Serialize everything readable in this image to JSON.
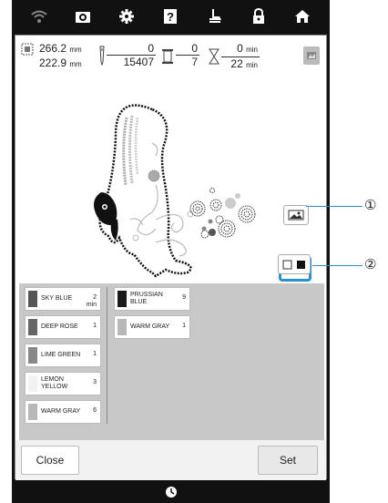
{
  "status_icons": [
    "wifi-icon",
    "camera-icon",
    "settings-gear-icon",
    "help-icon",
    "presser-foot-icon",
    "lock-icon",
    "home-icon"
  ],
  "info": {
    "width_value": "266.2",
    "width_unit": "mm",
    "height_value": "222.9",
    "height_unit": "mm",
    "stitch_current": "0",
    "stitch_total": "15407",
    "color_current": "0",
    "color_total": "7",
    "time_current": "0",
    "time_current_unit": "min",
    "time_total": "22",
    "time_total_unit": "min"
  },
  "thread_list": {
    "left_column": [
      {
        "name": "SKY BLUE",
        "count": "2",
        "unit": "min",
        "color": "#555555"
      },
      {
        "name": "DEEP ROSE",
        "count": "1",
        "color": "#666666"
      },
      {
        "name": "LIME GREEN",
        "count": "1",
        "color": "#888888"
      },
      {
        "name": "LEMON YELLOW",
        "count": "3",
        "color": "#f2f2f2"
      },
      {
        "name": "WARM GRAY",
        "count": "6",
        "color": "#b8b8b8"
      }
    ],
    "right_column": [
      {
        "name": "PRUSSIAN BLUE",
        "count": "9",
        "color": "#1a1a1a"
      },
      {
        "name": "WARM GRAY",
        "count": "1",
        "color": "#b8b8b8"
      }
    ]
  },
  "buttons": {
    "close": "Close",
    "set": "Set"
  },
  "callouts": [
    "①",
    "②"
  ],
  "colors": {
    "highlight": "#2c8fd0",
    "frame": "#111111"
  }
}
